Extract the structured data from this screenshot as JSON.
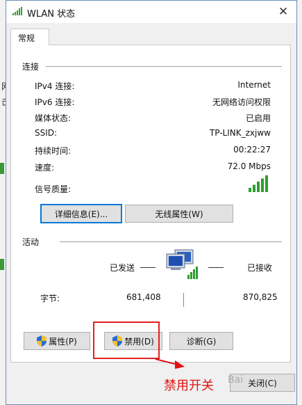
{
  "background": {
    "hints": [
      "网",
      "击"
    ]
  },
  "window": {
    "title": "WLAN 状态",
    "close_glyph": "✕",
    "tab": "常规"
  },
  "connection": {
    "section_label": "连接",
    "rows": [
      {
        "label": "IPv4 连接:",
        "value": "Internet"
      },
      {
        "label": "IPv6 连接:",
        "value": "无网络访问权限"
      },
      {
        "label": "媒体状态:",
        "value": "已启用"
      },
      {
        "label": "SSID:",
        "value": "TP-LINK_zxjww"
      },
      {
        "label": "持续时间:",
        "value": "00:22:27"
      },
      {
        "label": "速度:",
        "value": "72.0 Mbps"
      }
    ],
    "signal_label": "信号质量:",
    "signal_level": 5,
    "details_button": "详细信息(E)...",
    "wireless_button": "无线属性(W)"
  },
  "activity": {
    "section_label": "活动",
    "sent_label": "已发送",
    "received_label": "已接收",
    "bytes_label": "字节:",
    "bytes_sent": "681,408",
    "bytes_received": "870,825"
  },
  "buttons": {
    "properties": "属性(P)",
    "disable": "禁用(D)",
    "diagnose": "诊断(G)",
    "close": "关闭(C)"
  },
  "annotation": {
    "text": "禁用开关",
    "watermark": "Bai"
  },
  "colors": {
    "accent": "#0078d7",
    "signal": "#2e9e2e",
    "annotation": "#e01010"
  }
}
